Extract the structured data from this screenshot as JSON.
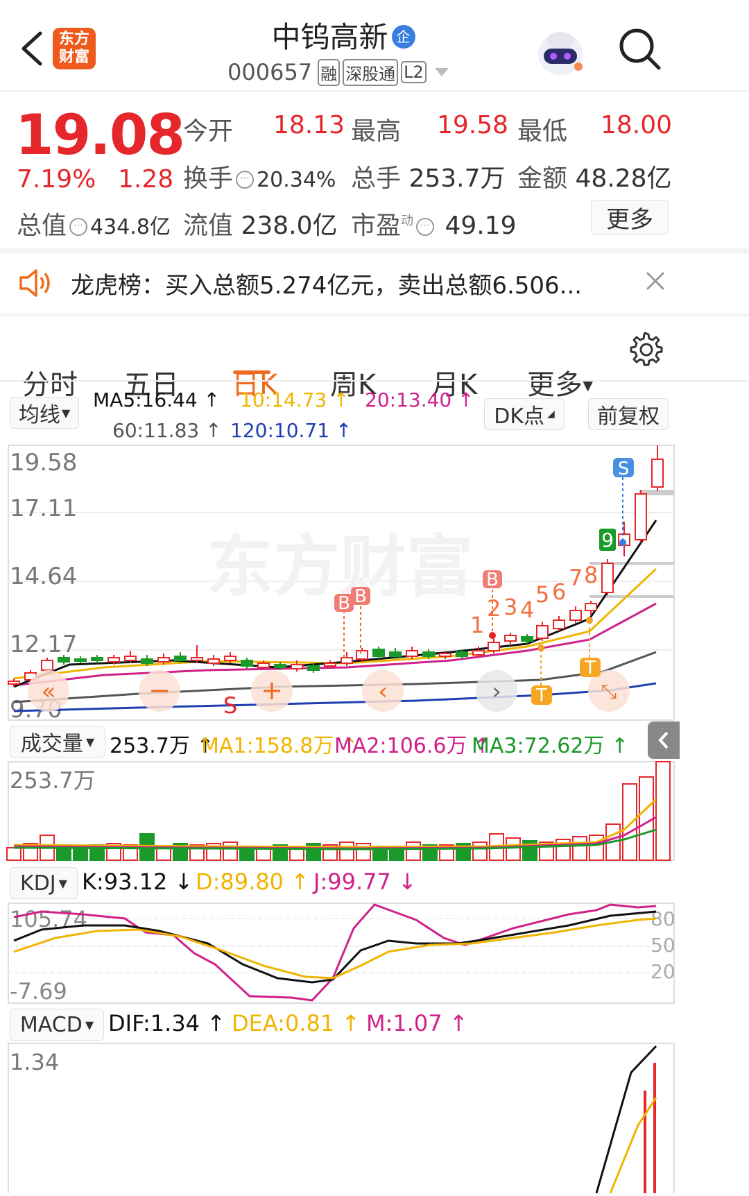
{
  "header": {
    "brand_logo": "东方\n财富",
    "stock_name": "中钨高新",
    "stock_badge": "企",
    "stock_code": "000657",
    "tags": [
      "融",
      "深股通",
      "L2"
    ]
  },
  "quote": {
    "price": "19.08",
    "change_pct": "7.19%",
    "change": "1.28",
    "open_label": "今开",
    "open": "18.13",
    "high_label": "最高",
    "high": "19.58",
    "low_label": "最低",
    "low": "18.00",
    "turnover_label": "换手",
    "turnover": "20.34%",
    "volume_label": "总手",
    "volume": "253.7万",
    "amount_label": "金额",
    "amount": "48.28亿",
    "mktcap_label": "总值",
    "mktcap": "434.8亿",
    "float_label": "流值",
    "float": "238.0亿",
    "pe_label": "市盈",
    "pe_sup": "动",
    "pe": "49.19",
    "more_button": "更多"
  },
  "notice": {
    "text": "龙虎榜：买入总额5.274亿元，卖出总额6.506..."
  },
  "tabs": [
    "分时",
    "五日",
    "日K",
    "周K",
    "月K",
    "更多"
  ],
  "active_tab": 2,
  "ma_bar": {
    "selector": "均线",
    "ma5": "MA5:16.44 ↑",
    "ma10": "10:14.73 ↑",
    "ma20": "20:13.40 ↑",
    "ma60": "60:11.83 ↑",
    "ma120": "120:10.71 ↑",
    "dk_button": "DK点",
    "adjust_button": "前复权"
  },
  "kline": {
    "y_labels": [
      "19.58",
      "17.11",
      "14.64",
      "12.17",
      "9.70"
    ],
    "watermark": "东方财富",
    "signal_labels": [
      "B",
      "B",
      "B",
      "S",
      "9",
      "T",
      "T",
      "S"
    ],
    "seq_numbers": [
      "1",
      "2",
      "3",
      "4",
      "5",
      "6",
      "7",
      "8"
    ]
  },
  "volume_bar": {
    "selector": "成交量",
    "vol": "253.7万 ↑",
    "ma1": "MA1:158.8万 ↑",
    "ma2": "MA2:106.6万 ↑",
    "ma3": "MA3:72.62万 ↑",
    "y_label": "253.7万"
  },
  "kdj_bar": {
    "selector": "KDJ",
    "k": "K:93.12 ↓",
    "d": "D:89.80 ↑",
    "j": "J:99.77 ↓",
    "y_top": "105.74",
    "y_bottom": "-7.69",
    "levels": [
      "80",
      "50",
      "20"
    ]
  },
  "macd_bar": {
    "selector": "MACD",
    "dif": "DIF:1.34 ↑",
    "dea": "DEA:0.81 ↑",
    "m": "M:1.07 ↑",
    "y_top": "1.34"
  },
  "colors": {
    "up": "#e5262a",
    "down": "#1a9a2a",
    "accent": "#ee6a1f",
    "ma5": "#111111",
    "ma10": "#f0b400",
    "ma20": "#d0218a",
    "ma60": "#555555",
    "ma120": "#1f3fb0"
  }
}
